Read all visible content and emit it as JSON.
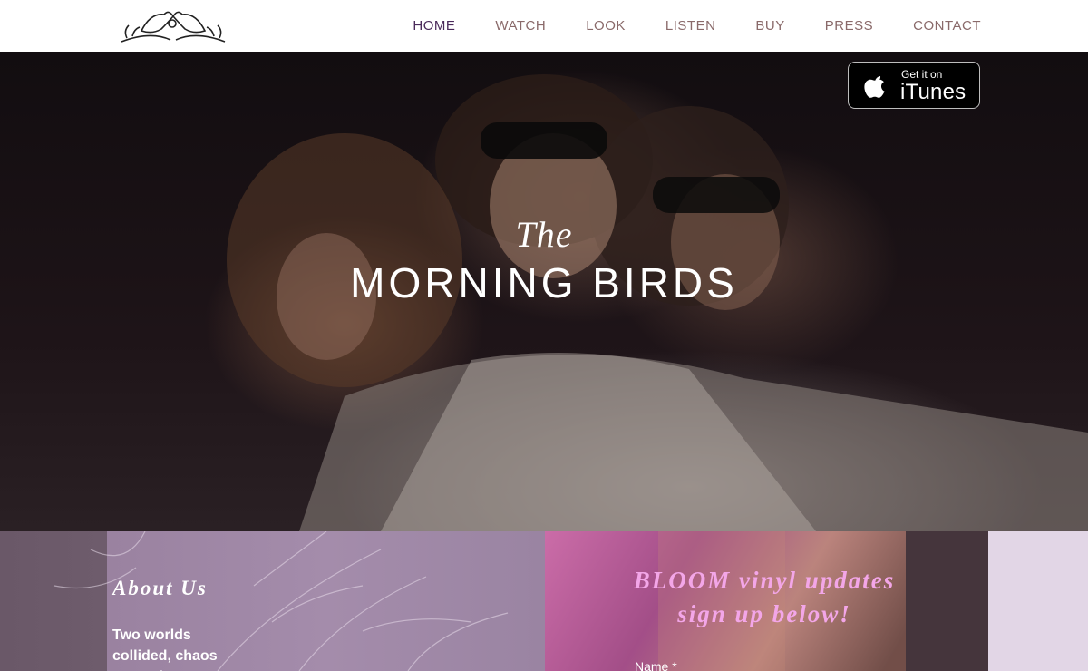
{
  "logo": {
    "icon": "doves-logo-icon"
  },
  "nav": {
    "items": [
      {
        "label": "HOME",
        "active": true
      },
      {
        "label": "WATCH"
      },
      {
        "label": "LOOK"
      },
      {
        "label": "LISTEN"
      },
      {
        "label": "BUY"
      },
      {
        "label": "PRESS"
      },
      {
        "label": "CONTACT"
      }
    ]
  },
  "hero": {
    "the": "The",
    "band_name": "MORNING BIRDS",
    "itunes": {
      "small": "Get it on",
      "big": "iTunes",
      "icon": "apple-icon"
    }
  },
  "about": {
    "title": "About Us",
    "text": "Two worlds collided, chaos ensued..."
  },
  "signup": {
    "title_line1": "BLOOM vinyl updates",
    "title_line2": "sign up below!",
    "name_label": "Name *"
  },
  "colors": {
    "nav_text": "#8a6a6a",
    "nav_active": "#4a2a5a",
    "signup_title": "#f3a6e8"
  }
}
